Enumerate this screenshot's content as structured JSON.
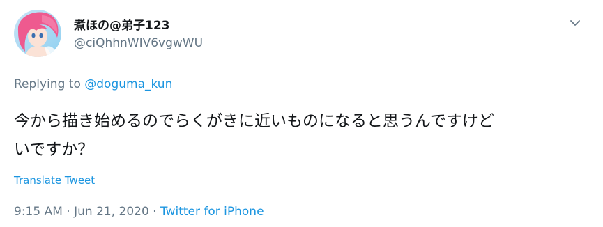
{
  "tweet": {
    "display_name": "煮ほの@弟子123",
    "handle": "@ciQhhnWIV6vgwWU",
    "replying_prefix": "Replying to ",
    "replying_to": "@doguma_kun",
    "text": "今から描き始めるのでらくがきに近いものになると思うんですけど\nいですか？",
    "translate_label": "Translate Tweet",
    "time": "9:15 AM",
    "separator": " · ",
    "date": "Jun 21, 2020",
    "source": "Twitter for iPhone",
    "menu_icon": "chevron-down-icon",
    "avatar_icon": "avatar"
  },
  "colors": {
    "text_primary": "#14171a",
    "text_secondary": "#657786",
    "link": "#1b95e0",
    "background": "#ffffff"
  }
}
